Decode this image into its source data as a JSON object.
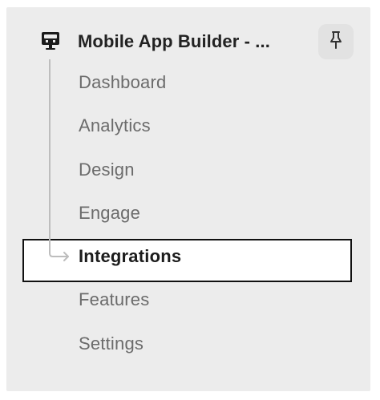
{
  "project": {
    "title": "Mobile App Builder - ...",
    "icon": "project-icon"
  },
  "pin": {
    "icon": "pin-icon"
  },
  "nav": {
    "items": [
      {
        "label": "Dashboard"
      },
      {
        "label": "Analytics"
      },
      {
        "label": "Design"
      },
      {
        "label": "Engage"
      },
      {
        "label": "Integrations"
      },
      {
        "label": "Features"
      },
      {
        "label": "Settings"
      }
    ],
    "active_item": "Integrations"
  },
  "colors": {
    "panel_background": "#ececec",
    "active_border": "#111111",
    "active_background": "#ffffff",
    "inactive_text": "#6b6b6b",
    "tree_line": "#bdbdbd"
  }
}
